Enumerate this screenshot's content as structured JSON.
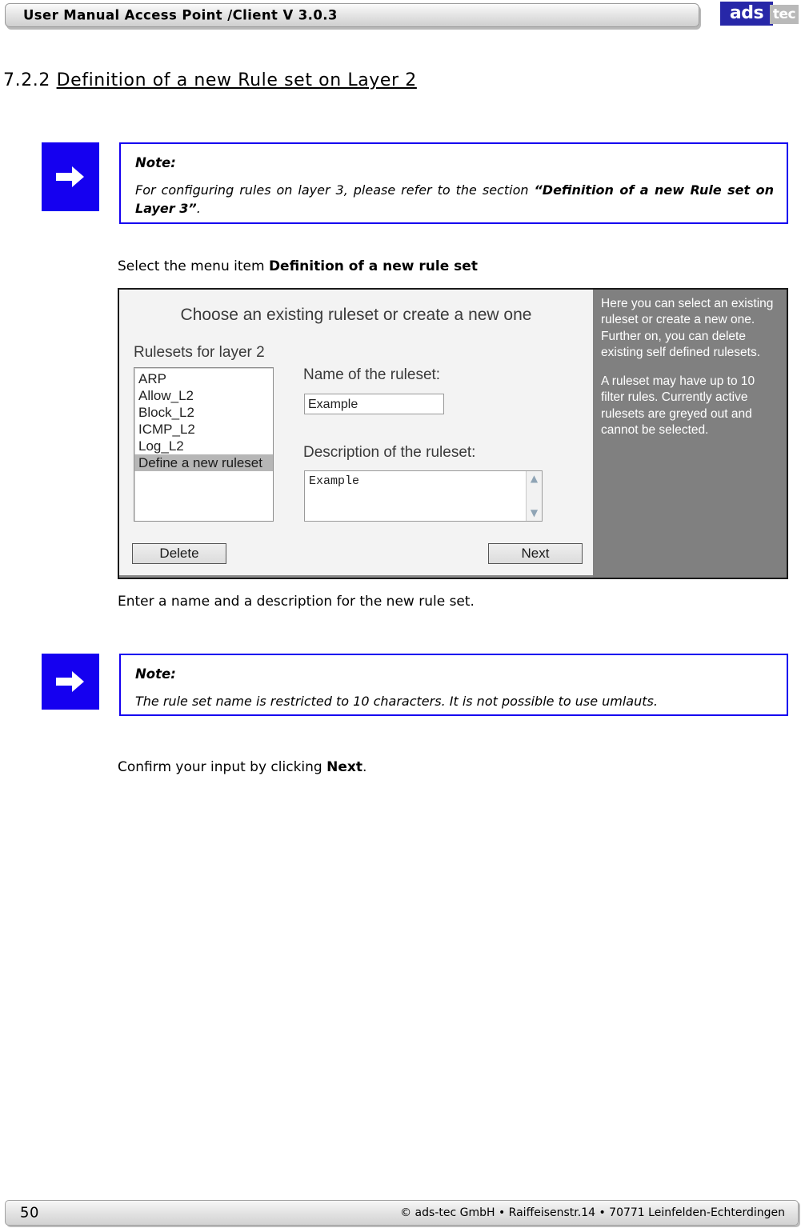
{
  "header": {
    "title": "User Manual Access Point /Client V 3.0.3",
    "logo_primary": "ads",
    "logo_secondary": "tec"
  },
  "heading": {
    "number": "7.2.2 ",
    "title": "Definition of a new Rule set on Layer 2"
  },
  "notes": [
    {
      "icon": "arrow-right-icon",
      "label": "Note:",
      "text_before": "For configuring rules on layer 3, please refer to the section ",
      "text_bold": "“Definition of a new Rule set on Layer 3”",
      "text_after": "."
    },
    {
      "icon": "arrow-right-icon",
      "label": "Note:",
      "text": "The rule set name is restricted to 10 characters. It is not possible to use umlauts."
    }
  ],
  "paragraphs": {
    "select_menu_prefix": "Select the menu item ",
    "select_menu_bold": "Definition of a new rule set",
    "enter_name": "Enter a name and a description for the new rule set.",
    "confirm_prefix": "Confirm your input by clicking ",
    "confirm_bold": "Next",
    "confirm_suffix": "."
  },
  "screenshot": {
    "title": "Choose an existing ruleset or create a new one",
    "rulesets_label": "Rulesets for layer 2",
    "ruleset_items": [
      "ARP",
      "Allow_L2",
      "Block_L2",
      "ICMP_L2",
      "Log_L2",
      "Define a new ruleset"
    ],
    "selected_item": "Define a new ruleset",
    "name_label": "Name of the ruleset:",
    "name_value": "Example",
    "desc_label": "Description of the ruleset:",
    "desc_value": "Example",
    "buttons": {
      "delete": "Delete",
      "next": "Next"
    },
    "help_paragraph_1": "Here you can select an existing ruleset or create a new one. Further on, you can delete existing self defined rulesets.",
    "help_paragraph_2": "A ruleset may have up to 10 filter rules. Currently active rulesets are greyed out and cannot be selected.",
    "scroll_up_glyph": "▲",
    "scroll_down_glyph": "▼"
  },
  "footer": {
    "page_number": "50",
    "copyright": "© ads-tec GmbH • Raiffeisenstr.14 • 70771 Leinfelden-Echterdingen"
  },
  "colors": {
    "note_blue": "#1500f0",
    "logo_blue": "#2727a8",
    "help_panel_gray": "#808080"
  }
}
